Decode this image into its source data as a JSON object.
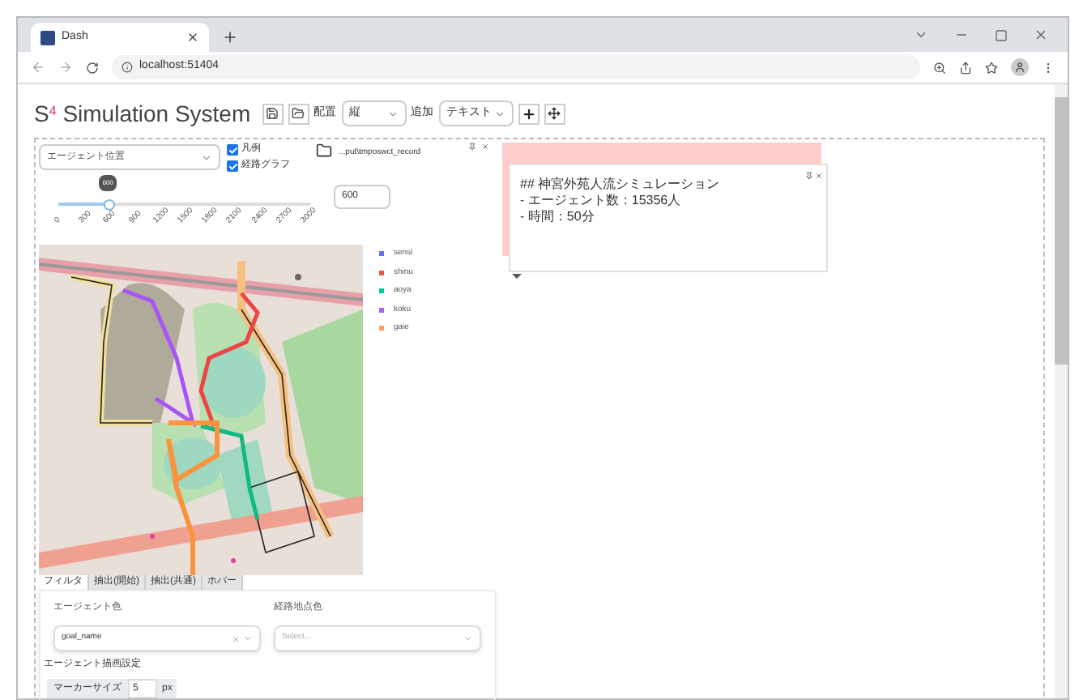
{
  "browser": {
    "tab_title": "Dash",
    "url": "localhost:51404"
  },
  "app": {
    "logo": "S",
    "logo_sup": "4",
    "title": "Simulation System",
    "layout_label": "配置",
    "layout_value": "縦",
    "add_label": "追加",
    "add_value": "テキスト"
  },
  "map_panel": {
    "layer_select": "エージェント位置",
    "checkboxes": [
      {
        "label": "凡例",
        "checked": true
      },
      {
        "label": "経路グラフ",
        "checked": true
      }
    ],
    "folder": "...put\\tmposwct_record",
    "slider": {
      "tooltip": "600",
      "level": 0.2,
      "ticks": [
        "0",
        "300",
        "600",
        "900",
        "1200",
        "1500",
        "1800",
        "2100",
        "2400",
        "2700",
        "3000"
      ]
    },
    "time_input": "600",
    "legend": [
      {
        "name": "sensi",
        "color": "#636efa"
      },
      {
        "name": "shinu",
        "color": "#ef553b"
      },
      {
        "name": "aoya",
        "color": "#00cc96"
      },
      {
        "name": "koku",
        "color": "#ab63fa"
      },
      {
        "name": "gaie",
        "color": "#ffa15a"
      }
    ]
  },
  "tabs": [
    {
      "label": "フィルタ",
      "selected": true
    },
    {
      "label": "抽出(開始)",
      "selected": false
    },
    {
      "label": "抽出(共通)",
      "selected": false
    },
    {
      "label": "ホバー",
      "selected": false
    }
  ],
  "settings": {
    "agent_color_label": "エージェント色",
    "agent_color_value": "goal_name",
    "route_color_label": "経路地点色",
    "route_color_placeholder": "Select...",
    "draw_settings_label": "エージェント描画設定",
    "marker_size_label": "マーカーサイズ",
    "marker_size_value": "5",
    "marker_size_unit": "px"
  },
  "text_panel": {
    "lines": [
      "## 神宮外苑人流シミュレーション",
      "- エージェント数：15356人",
      "- 時間：50分"
    ]
  }
}
